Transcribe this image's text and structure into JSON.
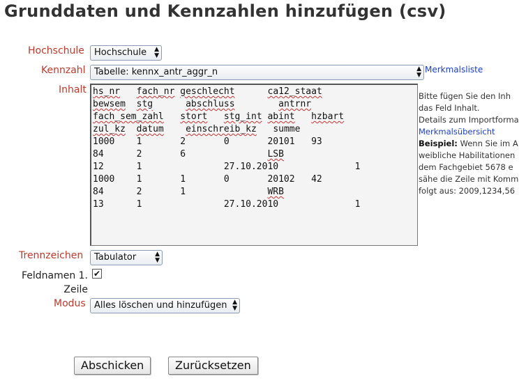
{
  "title": "Grunddaten und Kennzahlen hinzufügen (csv)",
  "fields": {
    "hochschule": {
      "label": "Hochschule",
      "value": "Hochschule"
    },
    "kennzahl": {
      "label": "Kennzahl",
      "value": "Tabelle: kennx_antr_aggr_n",
      "link": "Merkmalsliste"
    },
    "inhalt": {
      "label": "Inhalt",
      "lines": [
        [
          [
            "hs_nr",
            true
          ],
          [
            "   ",
            false
          ],
          [
            "fach_nr",
            true
          ],
          [
            " ",
            false
          ],
          [
            "geschlecht",
            true
          ],
          [
            "      ",
            false
          ],
          [
            "ca12_staat",
            true
          ]
        ],
        [
          [
            "bewsem",
            true
          ],
          [
            "  ",
            false
          ],
          [
            "stg",
            true
          ],
          [
            "      ",
            false
          ],
          [
            "abschluss",
            true
          ],
          [
            "        ",
            false
          ],
          [
            "antrnr",
            true
          ]
        ],
        [
          [
            "fach_sem_zahl",
            true
          ],
          [
            "   ",
            false
          ],
          [
            "stort",
            true
          ],
          [
            "   ",
            false
          ],
          [
            "stg_int",
            true
          ],
          [
            " ",
            false
          ],
          [
            "abint",
            true
          ],
          [
            "   ",
            false
          ],
          [
            "hzbart",
            true
          ]
        ],
        [
          [
            "zul_kz",
            true
          ],
          [
            "  ",
            false
          ],
          [
            "datum",
            true
          ],
          [
            "    ",
            false
          ],
          [
            "einschreib_kz",
            true
          ],
          [
            "   ",
            false
          ],
          [
            "summe",
            false
          ]
        ],
        [
          [
            "1000    1       2       0       20101   93",
            false
          ]
        ],
        [
          [
            "84      2       6               ",
            false
          ],
          [
            "LSB",
            true
          ]
        ],
        [
          [
            "12      1               27.10.2010              1",
            false
          ]
        ],
        [
          [
            "1000    1       1       0       20102   42",
            false
          ]
        ],
        [
          [
            "84      2       1               ",
            false
          ],
          [
            "WRB",
            true
          ]
        ],
        [
          [
            "13      1               27.10.2010              1",
            false
          ]
        ]
      ]
    },
    "trennzeichen": {
      "label": "Trennzeichen",
      "value": "Tabulator"
    },
    "feldnamen": {
      "label_line1": "Feldnamen 1.",
      "label_line2": "Zeile",
      "checked": true
    },
    "modus": {
      "label": "Modus",
      "value": "Alles löschen und hinzufügen"
    }
  },
  "help": {
    "line1": "Bitte fügen Sie den Inh",
    "line2": "das Feld Inhalt.",
    "line3": "Details zum Importforma",
    "link": "Merkmalsübersicht",
    "example_label": "Beispiel:",
    "example_line1": " Wenn Sie im A",
    "line5": "weibliche Habilitationen",
    "line6": "dem Fachgebiet 5678 e",
    "line7": "sähe die Zeile mit Komm",
    "line8": "folgt aus: 2009,1234,56"
  },
  "buttons": {
    "submit": "Abschicken",
    "reset": "Zurücksetzen"
  }
}
